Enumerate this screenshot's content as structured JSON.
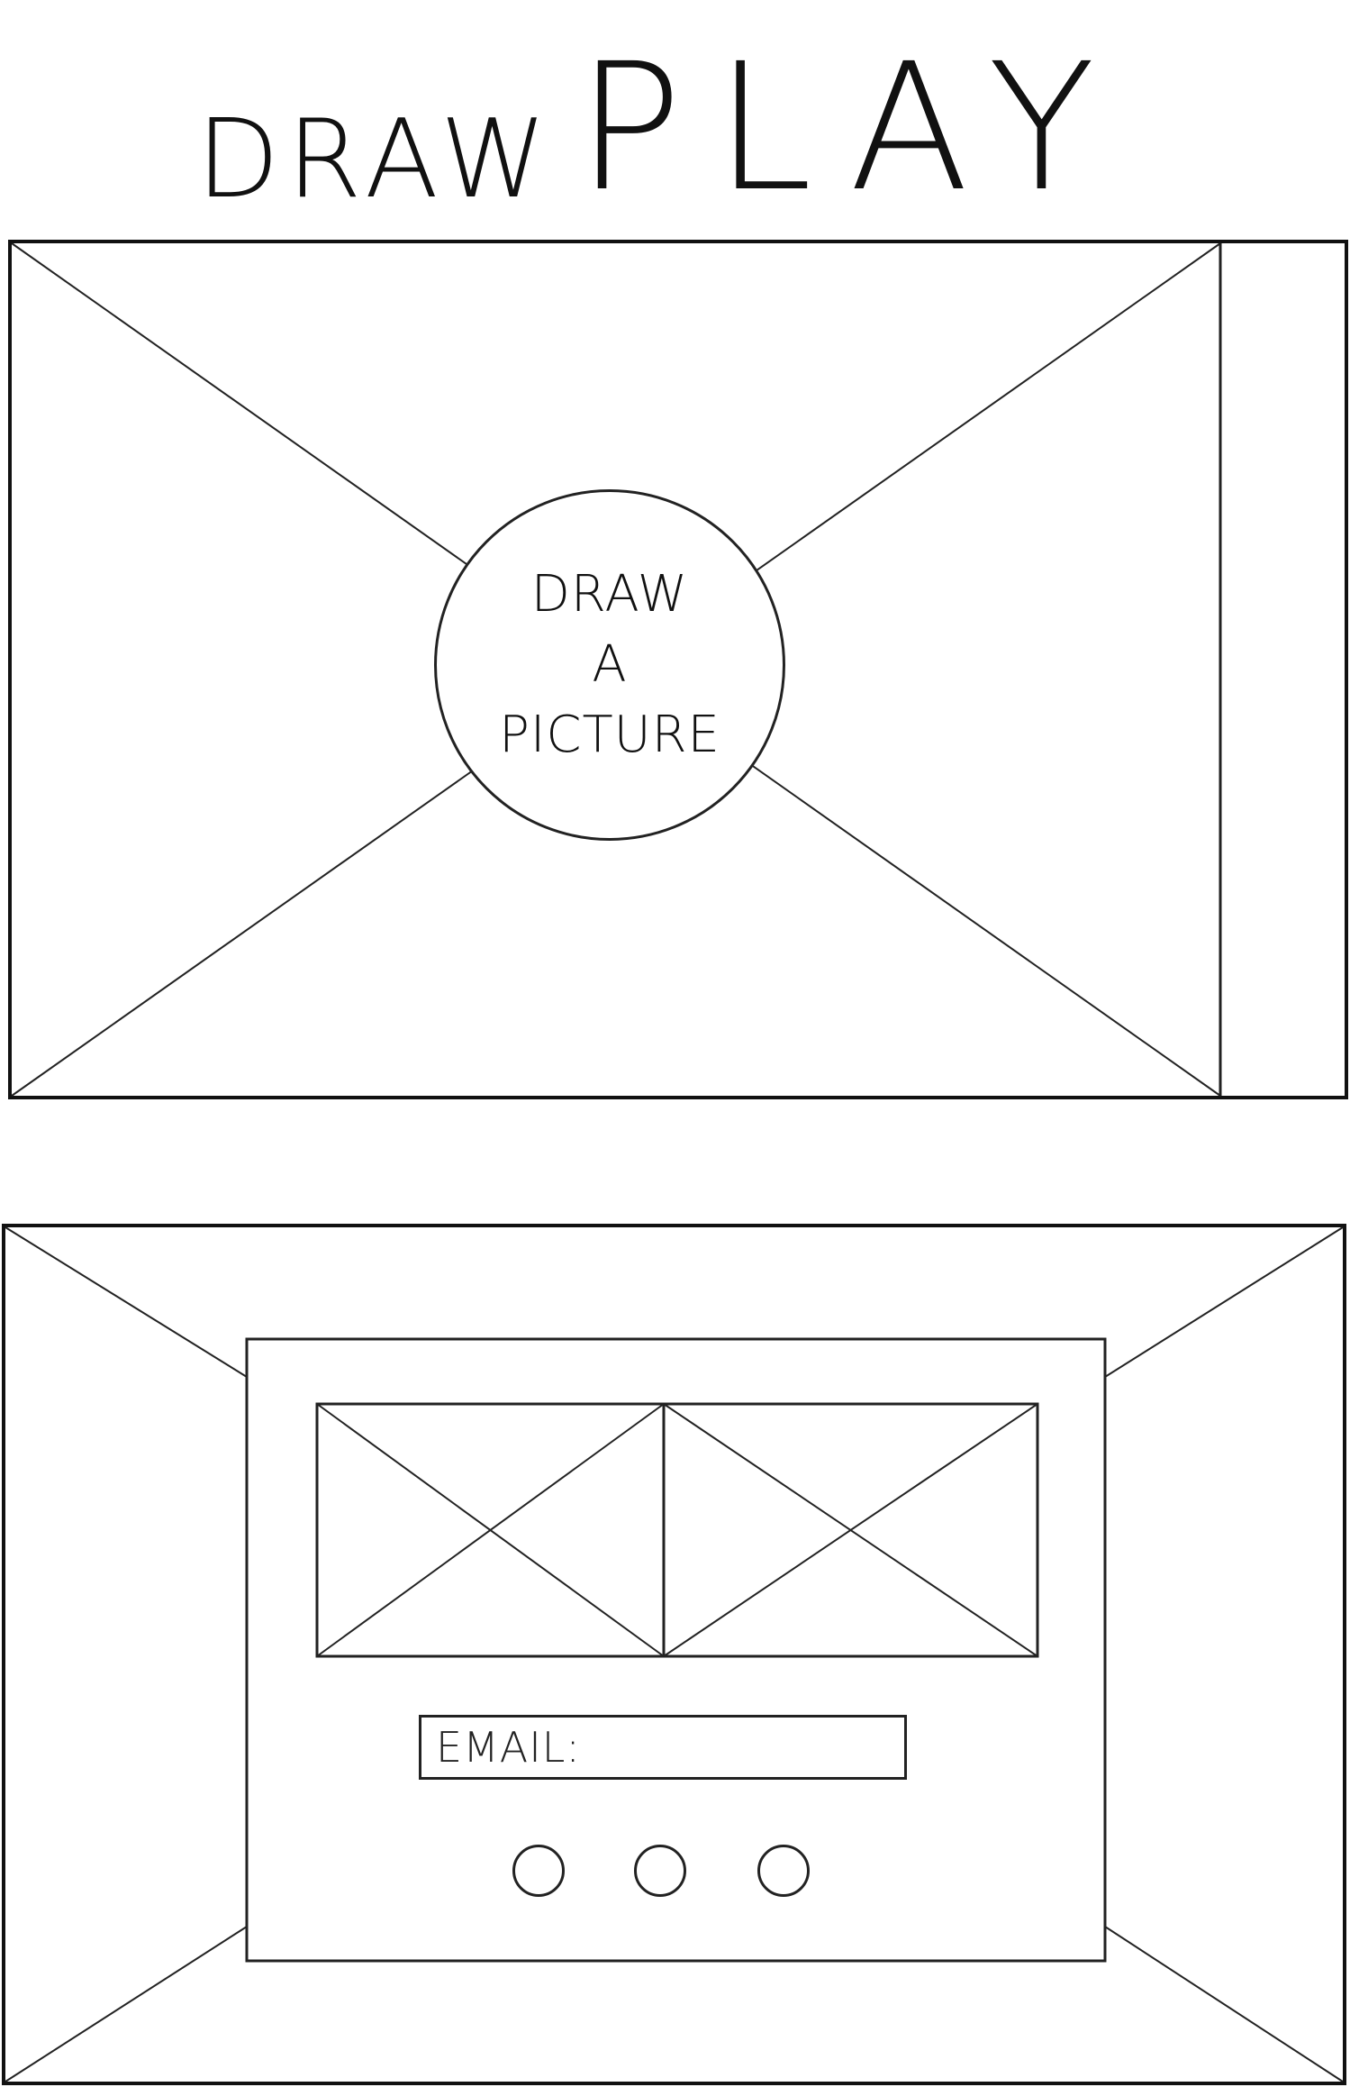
{
  "logo": {
    "word_draw": "DRAW",
    "word_play": "PLAY"
  },
  "canvas": {
    "button_lines": [
      "DRAW",
      "A",
      "PICTURE"
    ]
  },
  "share_modal": {
    "email_label": "EMAIL:",
    "dot_buttons": [
      "",
      "",
      ""
    ]
  }
}
